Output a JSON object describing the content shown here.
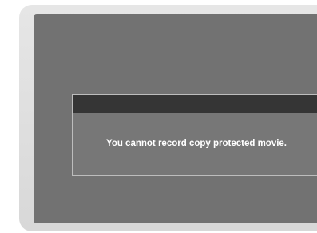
{
  "dialog": {
    "title": "",
    "message": "You cannot record copy protected movie."
  },
  "colors": {
    "screen_bezel": "#dddddd",
    "screen_background": "#727272",
    "dialog_background": "#777777",
    "dialog_titlebar": "#353535",
    "dialog_border": "#bdbdbd",
    "message_text": "#ffffff"
  }
}
